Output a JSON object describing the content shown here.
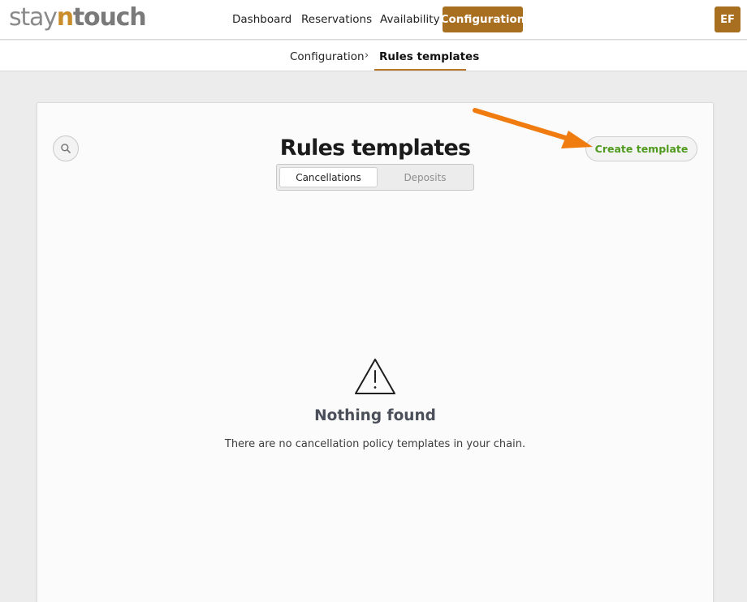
{
  "brand": {
    "logo_part1": "stay",
    "logo_part2": "n",
    "logo_part3": "touch",
    "accent_color": "#a96f21"
  },
  "nav": {
    "items": [
      {
        "label": "Dashboard"
      },
      {
        "label": "Reservations"
      },
      {
        "label": "Availability"
      },
      {
        "label": "Configuration",
        "active": true
      }
    ]
  },
  "user": {
    "initials": "EF"
  },
  "breadcrumb": {
    "items": [
      {
        "label": "Configuration"
      },
      {
        "label": "Rules templates",
        "active": true
      }
    ],
    "separator": "›"
  },
  "page": {
    "title": "Rules templates",
    "search_icon": "search-icon",
    "tabs": [
      {
        "label": "Cancellations",
        "selected": true
      },
      {
        "label": "Deposits",
        "selected": false
      }
    ],
    "create_button_label": "Create template",
    "annotation_color": "#f07c0f"
  },
  "empty_state": {
    "icon": "warning-triangle-icon",
    "title": "Nothing found",
    "message": "There are no cancellation policy templates in your chain."
  }
}
